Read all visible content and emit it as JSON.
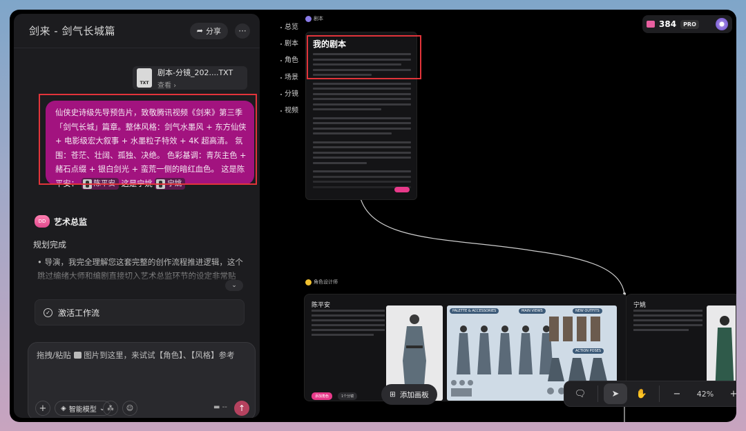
{
  "chat": {
    "title": "剑来 - 剑气长城篇",
    "share_label": "分享",
    "more_label": "···",
    "file": {
      "type_label": "TXT",
      "name": "剧本-分镜_202....TXT",
      "action": "查看 ›"
    },
    "prompt": {
      "text": "仙侠史诗级先导预告片，致敬腾讯视频《剑来》第三季「剑气长城」篇章。整体风格：剑气水墨风 + 东方仙侠 + 电影级宏大叙事 + 水墨粒子特效 + 4K 超高清。 氛围：苍茫、壮阔、孤独、决绝。 色彩基调：青灰主色 + 赭石点缀 + 银白剑光 + 蛮荒一侧的暗红血色。 这是陈平安：",
      "chip1": "陈平安",
      "mid": "这是宁姚",
      "chip2": "宁姚"
    },
    "agent": {
      "avatar_text": "DD",
      "name": "艺术总监",
      "status": "规划完成",
      "reply": "• 导演，我完全理解您这套完整的创作流程推进逻辑，这个跳过编绪大师和编剧直接切入艺术总监环节的设定非常贴"
    },
    "expand_label": "⌄",
    "workflow_label": "激活工作流",
    "input": {
      "placeholder_pre": "拖拽/粘贴",
      "placeholder_post": "图片到这里，来试试【角色】、【风格】参考",
      "model_label": "智能模型",
      "credit_label": "--",
      "plus": "+",
      "send": "↑"
    }
  },
  "outline": [
    "总览",
    "剧本",
    "角色",
    "场景",
    "分镜",
    "视频"
  ],
  "canvas": {
    "script_section": "剧本",
    "script_title": "我的剧本",
    "char_section": "角色设计师",
    "char1": {
      "name": "陈平安",
      "pill1": "添加角色",
      "pill2": "1个分镜",
      "sheet_tags": [
        "PALETTE & ACCESSORIES",
        "MAIN VIEWS",
        "NEW OUTFITS",
        "ACTION POSES"
      ]
    },
    "char2": {
      "name": "宁姚"
    },
    "add_board_label": "添加画板",
    "zoom": "42%",
    "zoom_minus": "−",
    "zoom_plus": "+"
  },
  "header": {
    "credits": "384",
    "badge": "PRO"
  },
  "colors": {
    "accent": "#e83a8a",
    "prompt_bg": "#a2137f",
    "highlight_frame": "#e2343a"
  },
  "icons": [
    "share-icon",
    "txt-file-icon",
    "check-circle-icon",
    "image-icon",
    "model-icon",
    "pointer-icon",
    "hand-icon",
    "feedback-icon",
    "add-board-icon",
    "credit-icon"
  ]
}
